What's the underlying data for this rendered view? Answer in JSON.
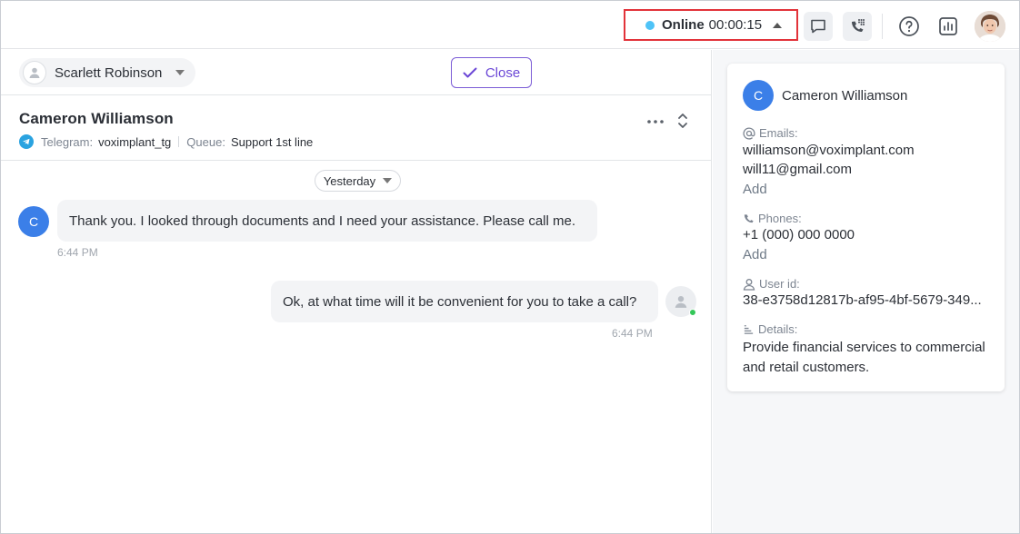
{
  "topbar": {
    "status": {
      "label": "Online",
      "timer": "00:00:15",
      "dot_color": "#4fc3f7"
    },
    "icons": [
      "chat-bubble-icon",
      "phone-dialpad-icon",
      "help-icon",
      "analytics-icon"
    ]
  },
  "chat": {
    "assignee": {
      "name": "Scarlett Robinson"
    },
    "close_label": "Close",
    "contact": {
      "name": "Cameron Williamson",
      "channel_key": "Telegram:",
      "channel_value": "voximplant_tg",
      "queue_key": "Queue:",
      "queue_value": "Support 1st line"
    },
    "date_divider": "Yesterday",
    "messages": [
      {
        "from": "client",
        "avatar": "C",
        "text": "Thank you. I looked through documents and I need your assistance. Please call me.",
        "time": "6:44 PM"
      },
      {
        "from": "agent",
        "text": "Ok, at what time will it be convenient for you to take a call?",
        "time": "6:44 PM"
      }
    ]
  },
  "info": {
    "avatar": "C",
    "name": "Cameron Williamson",
    "emails_label": "Emails:",
    "emails": [
      "williamson@voximplant.com",
      "will11@gmail.com"
    ],
    "emails_add": "Add",
    "phones_label": "Phones:",
    "phones": [
      "+1 (000) 000 0000"
    ],
    "phones_add": "Add",
    "userid_label": "User id:",
    "userid": "38-e3758d12817b-af95-4bf-5679-349...",
    "details_label": "Details:",
    "details": "Provide financial services to commercial and retail customers."
  },
  "colors": {
    "accent": "#6b47d6",
    "client_avatar": "#3b7fe8",
    "telegram": "#2aa3e0",
    "online": "#34c759",
    "highlight": "#e2333a"
  }
}
